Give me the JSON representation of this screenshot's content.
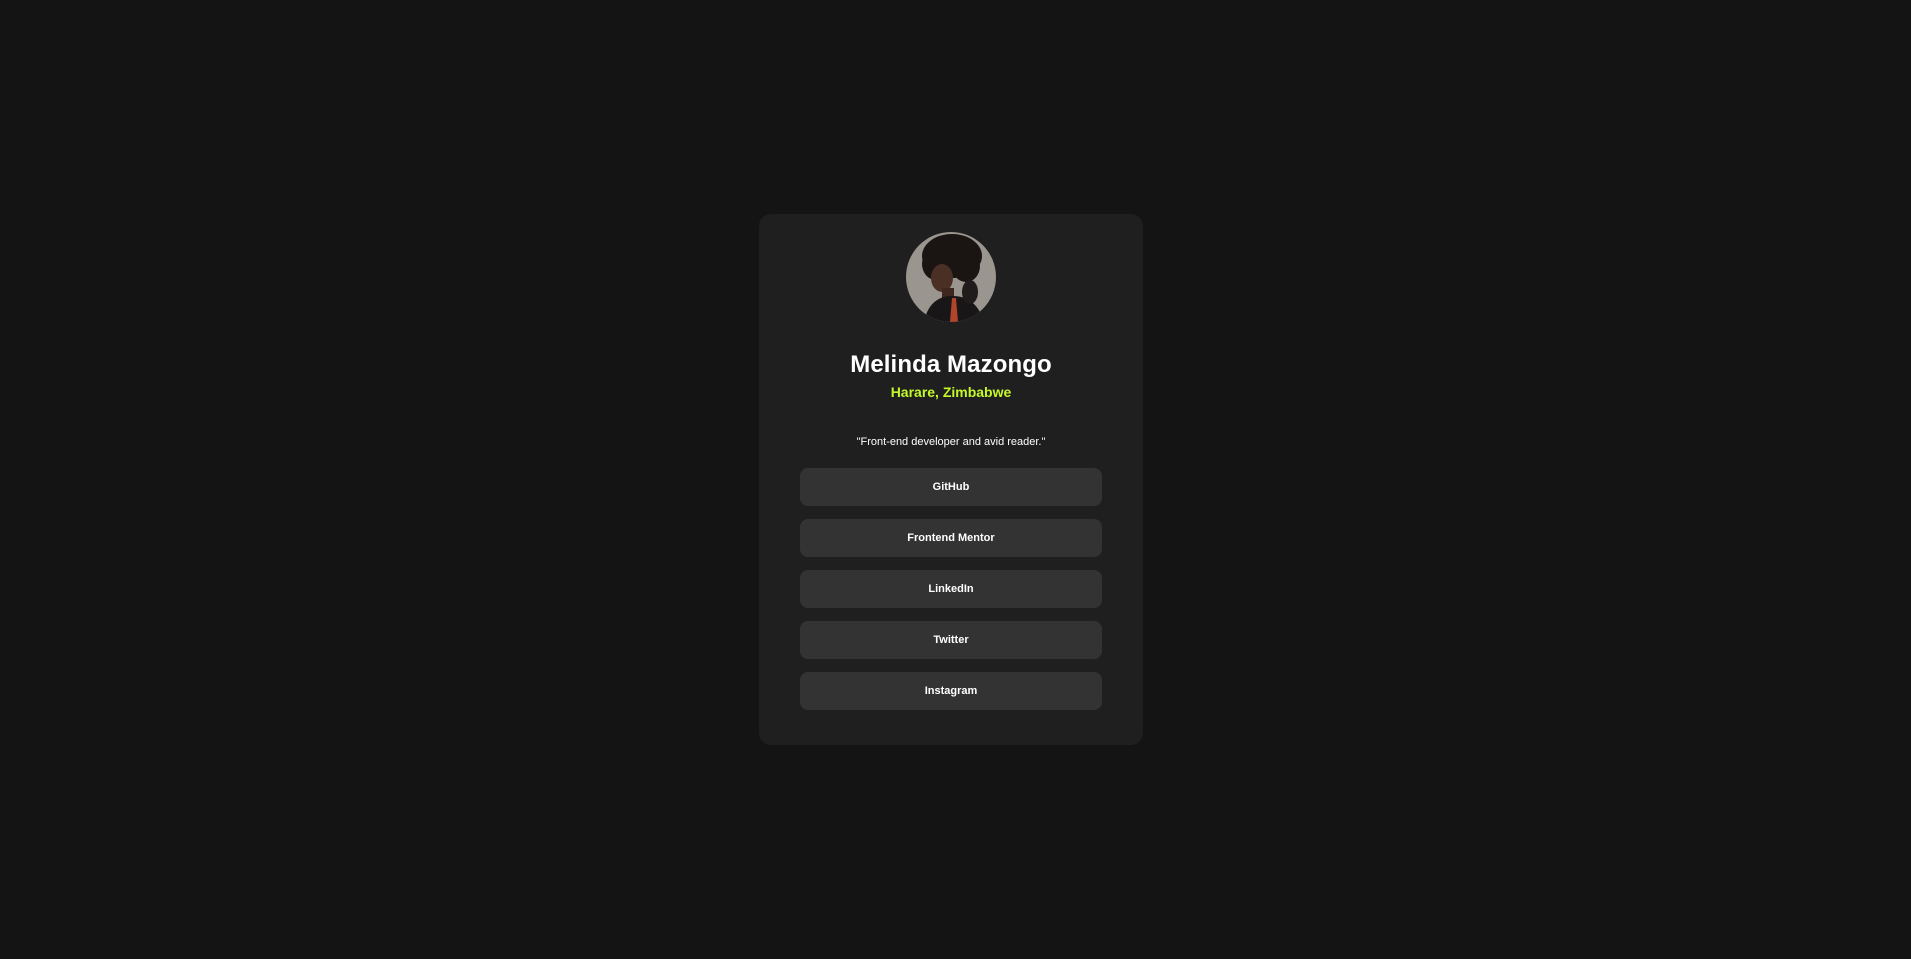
{
  "profile": {
    "avatar_alt": "Melinda Mazongo avatar",
    "name": "Melinda Mazongo",
    "location": "Harare, Zimbabwe",
    "bio": "\"Front-end developer and avid reader.\""
  },
  "links": [
    {
      "label": "GitHub"
    },
    {
      "label": "Frontend Mentor"
    },
    {
      "label": "LinkedIn"
    },
    {
      "label": "Twitter"
    },
    {
      "label": "Instagram"
    }
  ],
  "colors": {
    "page_background": "#141414",
    "card_background": "#1f1f1f",
    "button_background": "#333333",
    "accent": "#c4f82a",
    "text": "#ffffff"
  }
}
